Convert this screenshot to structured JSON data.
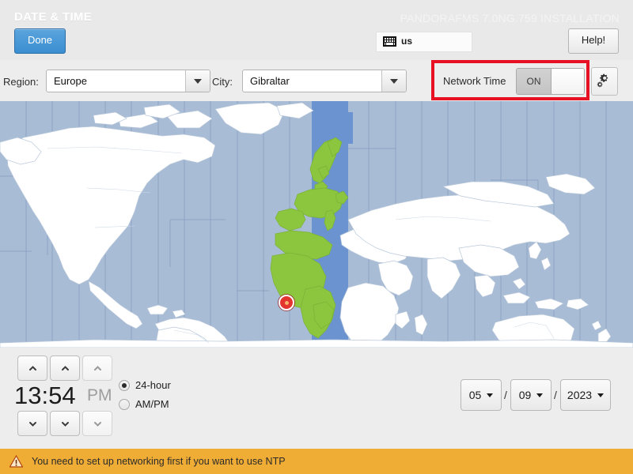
{
  "header": {
    "spoke_title": "DATE & TIME",
    "distro_title": "PANDORAFMS 7.0NG.759 INSTALLATION",
    "done_label": "Done",
    "help_label": "Help!",
    "keyboard_layout": "us",
    "keyboard_icon": "keyboard-icon"
  },
  "selectors": {
    "region_label": "Region:",
    "region_value": "Europe",
    "city_label": "City:",
    "city_value": "Gibraltar",
    "network_time_label": "Network Time",
    "network_time_state": "ON",
    "gear_icon": "gear-icon",
    "highlight_color": "#e81123"
  },
  "map": {
    "ocean_color": "#a8bcd6",
    "selected_zone_color": "#6b93d0",
    "land_color": "#ffffff",
    "highlight_country_color": "#8cc63f",
    "marker_icon": "location-pin-icon"
  },
  "time": {
    "value": "13:54",
    "ampm": "PM",
    "format_24h_label": "24-hour",
    "format_ampm_label": "AM/PM",
    "format_selected": "24-hour",
    "up_icon": "chevron-up-icon",
    "down_icon": "chevron-down-icon"
  },
  "date": {
    "month": "05",
    "day": "09",
    "year": "2023",
    "separator": "/"
  },
  "warning": {
    "icon": "warning-triangle-icon",
    "text": "You need to set up networking first if you want to use NTP",
    "background": "#f0ad36"
  }
}
